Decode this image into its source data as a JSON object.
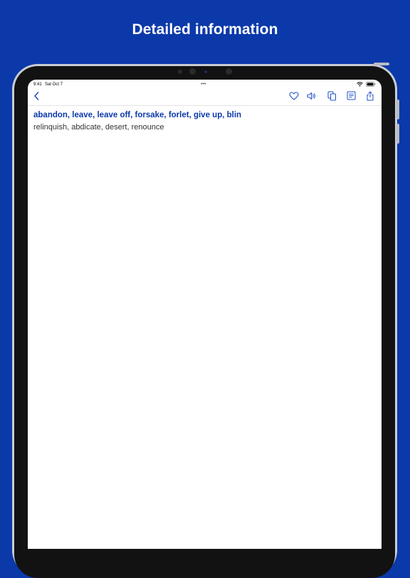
{
  "promo": {
    "title": "Detailed information"
  },
  "status_bar": {
    "time": "9:41",
    "date": "Sat Oct 7",
    "multitask_dots": "•••"
  },
  "nav": {
    "icons": [
      "back-chevron-icon",
      "heart-icon",
      "speaker-icon",
      "copy-icon",
      "note-icon",
      "share-icon"
    ],
    "accent_color": "#1e4fc4"
  },
  "entry": {
    "headword": "abandon, leave, leave off, forsake, forlet, give up, blin",
    "synonyms": "relinquish, abdicate, desert, renounce"
  },
  "colors": {
    "background": "#0b39aa",
    "headword": "#0b39aa",
    "body_text": "#333333"
  }
}
